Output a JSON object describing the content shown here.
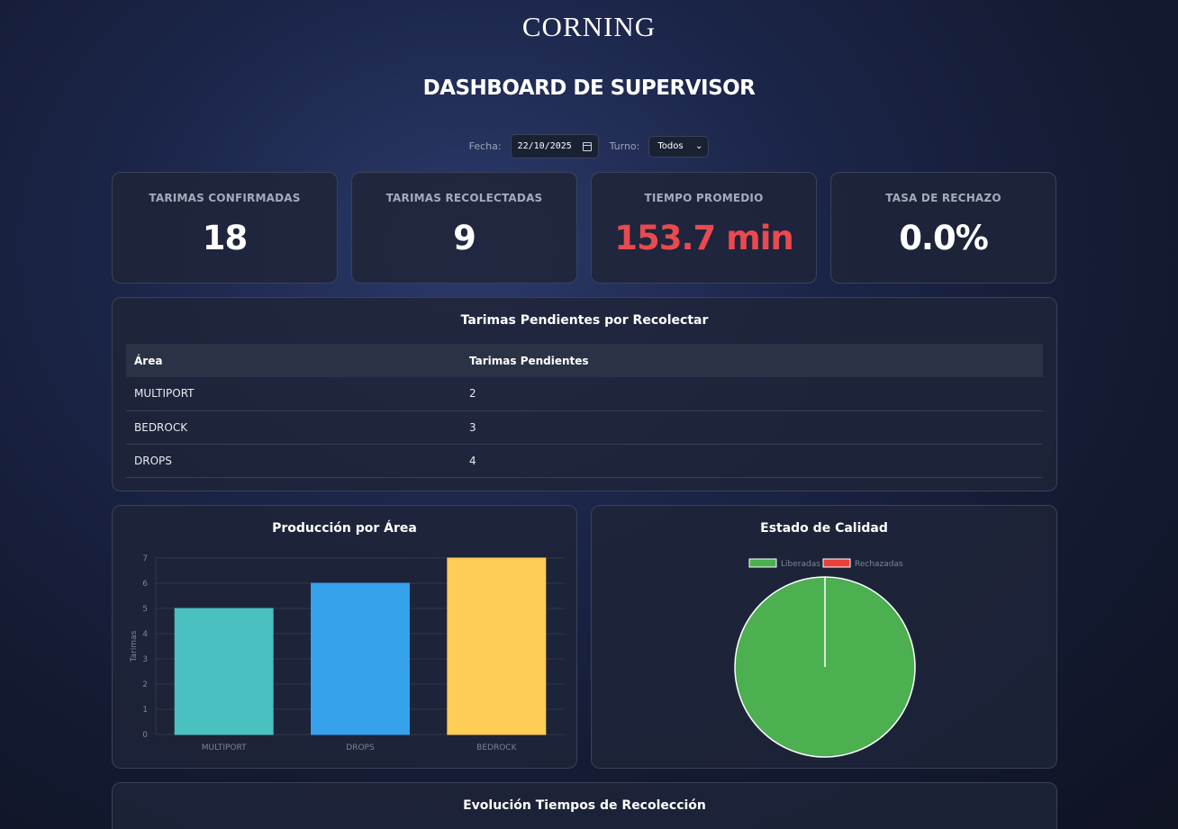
{
  "brand": {
    "logo_text": "CORNING"
  },
  "header": {
    "title": "DASHBOARD DE SUPERVISOR"
  },
  "filters": {
    "date_label": "Fecha:",
    "date_value": "22/10/2025",
    "shift_label": "Turno:",
    "shift_value": "Todos"
  },
  "kpis": [
    {
      "label": "TARIMAS CONFIRMADAS",
      "value": "18"
    },
    {
      "label": "TARIMAS RECOLECTADAS",
      "value": "9"
    },
    {
      "label": "TIEMPO PROMEDIO",
      "value": "153.7 min"
    },
    {
      "label": "TASA DE RECHAZO",
      "value": "0.0%"
    }
  ],
  "pending": {
    "title": "Tarimas Pendientes por Recolectar",
    "columns": [
      "Área",
      "Tarimas Pendientes"
    ],
    "rows": [
      {
        "area": "MULTIPORT",
        "count": "2"
      },
      {
        "area": "BEDROCK",
        "count": "3"
      },
      {
        "area": "DROPS",
        "count": "4"
      }
    ]
  },
  "colors": {
    "danger": "#e84a4f",
    "teal": "#4bc0c0",
    "blue": "#36a2eb",
    "yellow": "#ffcd56",
    "green": "#4caf50",
    "red": "#e8413c"
  },
  "production_chart": {
    "title": "Producción por Área",
    "chart_data": {
      "type": "bar",
      "categories": [
        "MULTIPORT",
        "DROPS",
        "BEDROCK"
      ],
      "values": [
        5,
        6,
        7
      ],
      "ylabel": "Tarimas",
      "ylim": [
        0,
        7
      ],
      "yticks": [
        0,
        1,
        2,
        3,
        4,
        5,
        6,
        7
      ],
      "colors": [
        "#4bc0c0",
        "#36a2eb",
        "#ffcd56"
      ]
    }
  },
  "quality_chart": {
    "title": "Estado de Calidad",
    "chart_data": {
      "type": "pie",
      "labels": [
        "Liberadas",
        "Rechazadas"
      ],
      "values": [
        9,
        0
      ],
      "colors": [
        "#4caf50",
        "#e8413c"
      ],
      "legend_position": "top"
    }
  },
  "evolution_chart": {
    "title": "Evolución Tiempos de Recolección"
  }
}
